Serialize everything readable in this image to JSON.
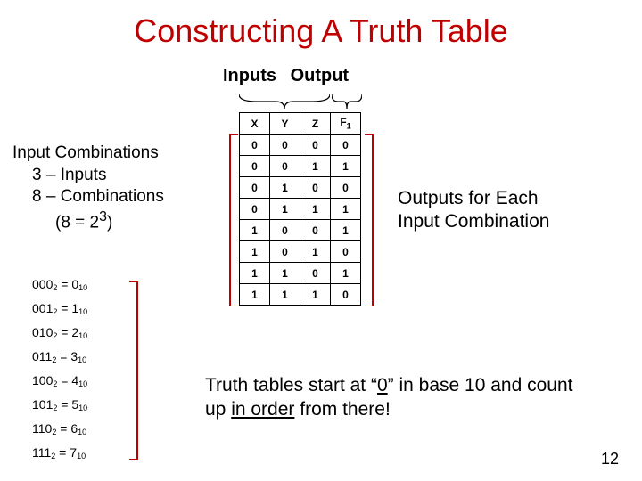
{
  "title": "Constructing A Truth Table",
  "header": {
    "inputs": "Inputs",
    "output": "Output"
  },
  "table": {
    "cols": [
      "X",
      "Y",
      "Z",
      "F"
    ],
    "f_sub": "1",
    "rows": [
      [
        "0",
        "0",
        "0",
        "0"
      ],
      [
        "0",
        "0",
        "1",
        "1"
      ],
      [
        "0",
        "1",
        "0",
        "0"
      ],
      [
        "0",
        "1",
        "1",
        "1"
      ],
      [
        "1",
        "0",
        "0",
        "1"
      ],
      [
        "1",
        "0",
        "1",
        "0"
      ],
      [
        "1",
        "1",
        "0",
        "1"
      ],
      [
        "1",
        "1",
        "1",
        "0"
      ]
    ]
  },
  "input_combos": {
    "l1": "Input Combinations",
    "l2": "3 – Inputs",
    "l3": "8 – Combinations",
    "l4_pre": "(8 = 2",
    "l4_sup": "3",
    "l4_post": ")"
  },
  "outputs_label": {
    "l1": "Outputs for Each",
    "l2": "Input Combination"
  },
  "conversions": [
    {
      "bin": "000",
      "dec": "0"
    },
    {
      "bin": "001",
      "dec": "1"
    },
    {
      "bin": "010",
      "dec": "2"
    },
    {
      "bin": "011",
      "dec": "3"
    },
    {
      "bin": "100",
      "dec": "4"
    },
    {
      "bin": "101",
      "dec": "5"
    },
    {
      "bin": "110",
      "dec": "6"
    },
    {
      "bin": "111",
      "dec": "7"
    }
  ],
  "footer": {
    "pre": "Truth tables start at “",
    "zero": "0",
    "mid": "” in base 10 and count up ",
    "order": "in order",
    "post": " from there!"
  },
  "slide_number": "12"
}
